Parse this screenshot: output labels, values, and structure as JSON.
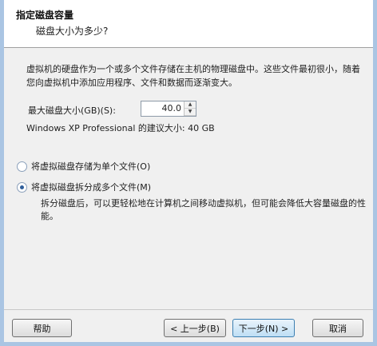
{
  "header": {
    "title": "指定磁盘容量",
    "subtitle": "磁盘大小为多少?"
  },
  "description": "虚拟机的硬盘作为一个或多个文件存储在主机的物理磁盘中。这些文件最初很小，随着您向虚拟机中添加应用程序、文件和数据而逐渐变大。",
  "disk_size": {
    "label": "最大磁盘大小(GB)(S):",
    "value": "40.0",
    "recommendation": "Windows XP Professional 的建议大小: 40 GB"
  },
  "options": {
    "single_file": {
      "label": "将虚拟磁盘存储为单个文件(O)",
      "selected": false
    },
    "split_files": {
      "label": "将虚拟磁盘拆分成多个文件(M)",
      "selected": true
    },
    "split_note": "拆分磁盘后，可以更轻松地在计算机之间移动虚拟机，但可能会降低大容量磁盘的性能。"
  },
  "buttons": {
    "help": "帮助",
    "back": "< 上一步(B)",
    "next": "下一步(N) >",
    "cancel": "取消"
  }
}
